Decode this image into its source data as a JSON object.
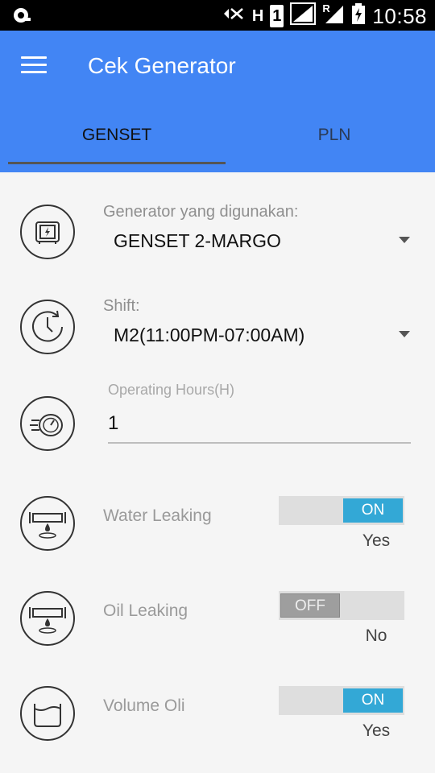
{
  "status_bar": {
    "time": "10:58",
    "icons": [
      "notification-icon",
      "mute-icon",
      "hspa-icon",
      "sim1-icon",
      "signal-icon",
      "roaming-signal-icon",
      "battery-charging-icon"
    ],
    "glyph_h": "H",
    "glyph_sim": "1",
    "glyph_r": "R"
  },
  "app_bar": {
    "title": "Cek Generator",
    "color": "#4285f4"
  },
  "tabs": [
    {
      "label": "GENSET",
      "selected": true
    },
    {
      "label": "PLN",
      "selected": false
    }
  ],
  "form": {
    "generator": {
      "label": "Generator yang digunakan:",
      "value": "GENSET 2-MARGO",
      "icon": "generator-icon"
    },
    "shift": {
      "label": "Shift:",
      "value": "M2(11:00PM-07:00AM)",
      "icon": "clock-icon"
    },
    "operating_hours": {
      "label": "Operating Hours(H)",
      "value": "1",
      "icon": "stopwatch-icon"
    },
    "water_leaking": {
      "label": "Water Leaking",
      "switch_text": "ON",
      "state_text": "Yes",
      "icon": "water-leak-icon"
    },
    "oil_leaking": {
      "label": "Oil Leaking",
      "switch_text": "OFF",
      "state_text": "No",
      "icon": "oil-leak-icon"
    },
    "volume_oli": {
      "label": "Volume Oli",
      "switch_text": "ON",
      "state_text": "Yes",
      "icon": "oil-volume-icon"
    }
  },
  "colors": {
    "switch_on": "#33a8d6",
    "switch_off": "#9e9e9e"
  }
}
